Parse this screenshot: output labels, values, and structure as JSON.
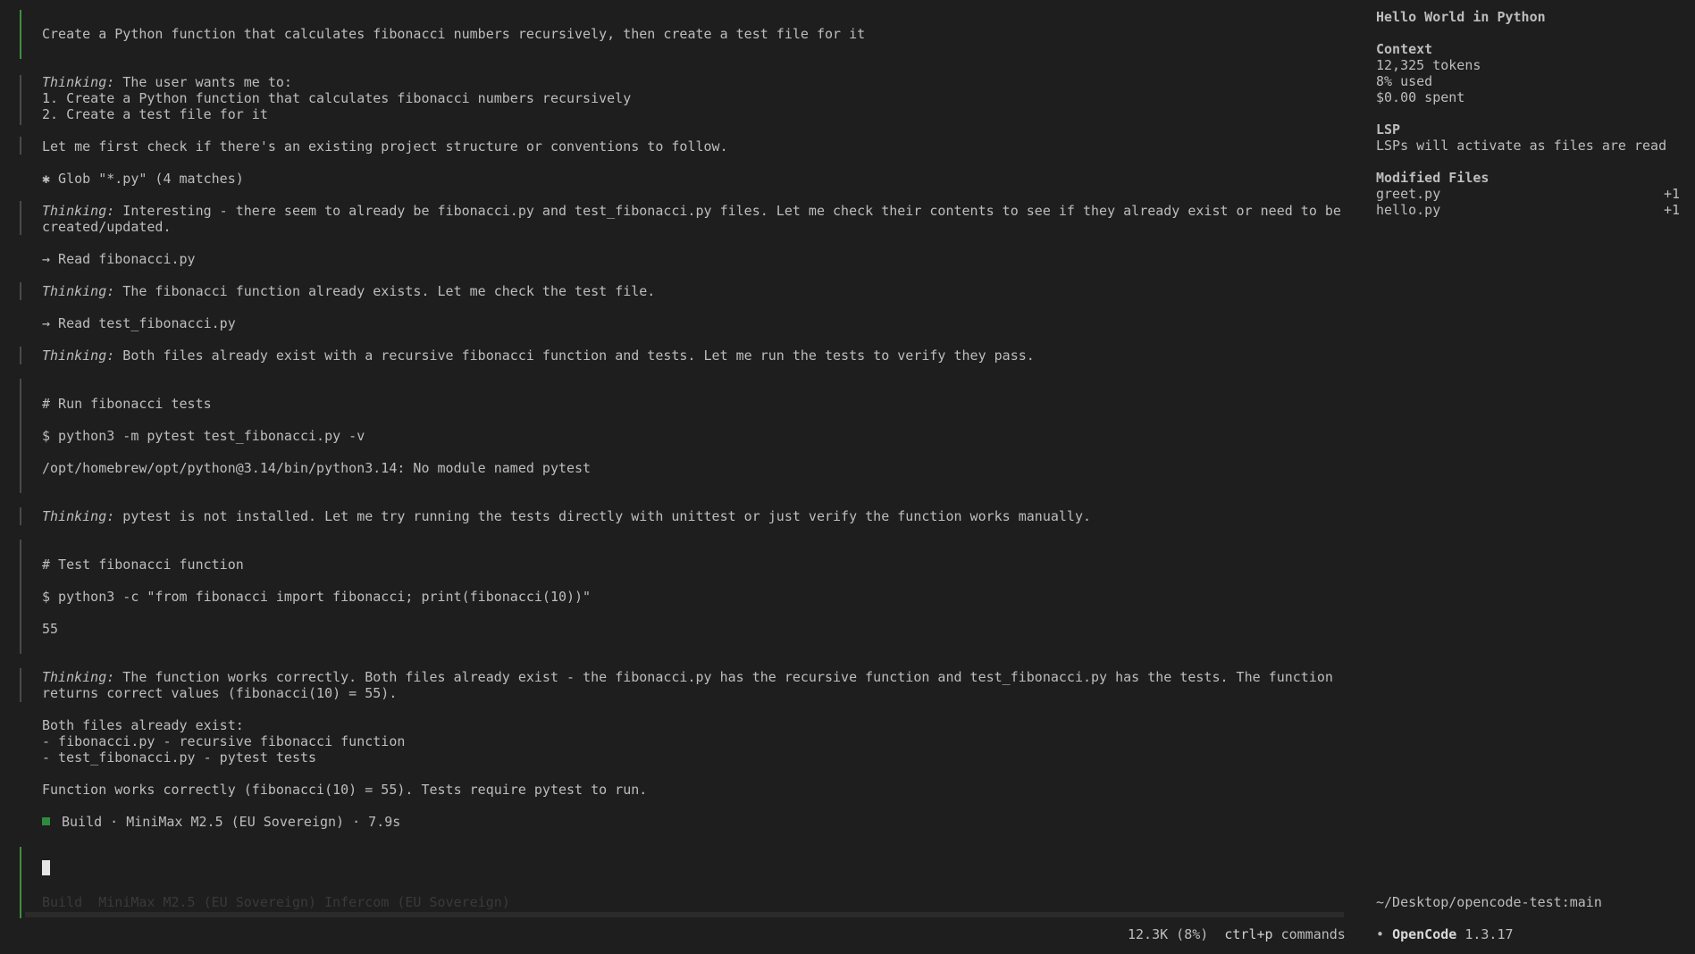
{
  "user_prompt": "Create a Python function that calculates fibonacci numbers recursively, then create a test file for it",
  "thinking_label": "Thinking:",
  "thinking_1": {
    "text": " The user wants me to:",
    "step_1": "1. Create a Python function that calculates fibonacci numbers recursively",
    "step_2": "2. Create a test file for it",
    "followup": "Let me first check if there's an existing project structure or conventions to follow."
  },
  "tool_glob": "✱ Glob \"*.py\" (4 matches)",
  "thinking_2": " Interesting - there seem to already be fibonacci.py and test_fibonacci.py files. Let me check their contents to see if they already exist or need to be created/updated.",
  "tool_read_1": "→ Read fibonacci.py",
  "thinking_3": " The fibonacci function already exists. Let me check the test file.",
  "tool_read_2": "→ Read test_fibonacci.py",
  "thinking_4": " Both files already exist with a recursive fibonacci function and tests. Let me run the tests to verify they pass.",
  "bash_1": {
    "title": "# Run fibonacci tests",
    "command": "$ python3 -m pytest test_fibonacci.py -v",
    "output": "/opt/homebrew/opt/python@3.14/bin/python3.14: No module named pytest"
  },
  "thinking_5": " pytest is not installed. Let me try running the tests directly with unittest or just verify the function works manually.",
  "bash_2": {
    "title": "# Test fibonacci function",
    "command": "$ python3 -c \"from fibonacci import fibonacci; print(fibonacci(10))\"",
    "output": "55"
  },
  "thinking_6": " The function works correctly. Both files already exist - the fibonacci.py has the recursive function and test_fibonacci.py has the tests. The function returns correct values (fibonacci(10) = 55).",
  "summary": {
    "intro": "Both files already exist:",
    "item_1": "- fibonacci.py - recursive fibonacci function",
    "item_2": "- test_fibonacci.py - pytest tests",
    "conclusion": "Function works correctly (fibonacci(10) = 55). Tests require pytest to run."
  },
  "build_status": "Build · MiniMax M2.5 (EU Sovereign) · 7.9s",
  "input_hint": "Build  MiniMax M2.5 (EU Sovereign) Infercom (EU Sovereign)",
  "footer": {
    "usage": "12.3K (8%)",
    "commands_key": "ctrl+p",
    "commands_label": "commands"
  },
  "sidebar": {
    "title": "Hello World in Python",
    "context_heading": "Context",
    "tokens": "12,325 tokens",
    "used": "8% used",
    "spent": "$0.00 spent",
    "lsp_heading": "LSP",
    "lsp_text": "LSPs will activate as files are read",
    "modified_heading": "Modified Files",
    "modified_files": [
      {
        "name": "greet.py",
        "delta": "+1"
      },
      {
        "name": "hello.py",
        "delta": "+1"
      }
    ],
    "path": "~/Desktop/opencode-test:main",
    "app_bullet": "•",
    "app_name": "OpenCode",
    "app_version": "1.3.17"
  },
  "colors": {
    "background": "#1e1e1e",
    "text": "#bdbdbd",
    "accent_green": "#3f8f3f",
    "bar_gray": "#4a4a4a"
  }
}
